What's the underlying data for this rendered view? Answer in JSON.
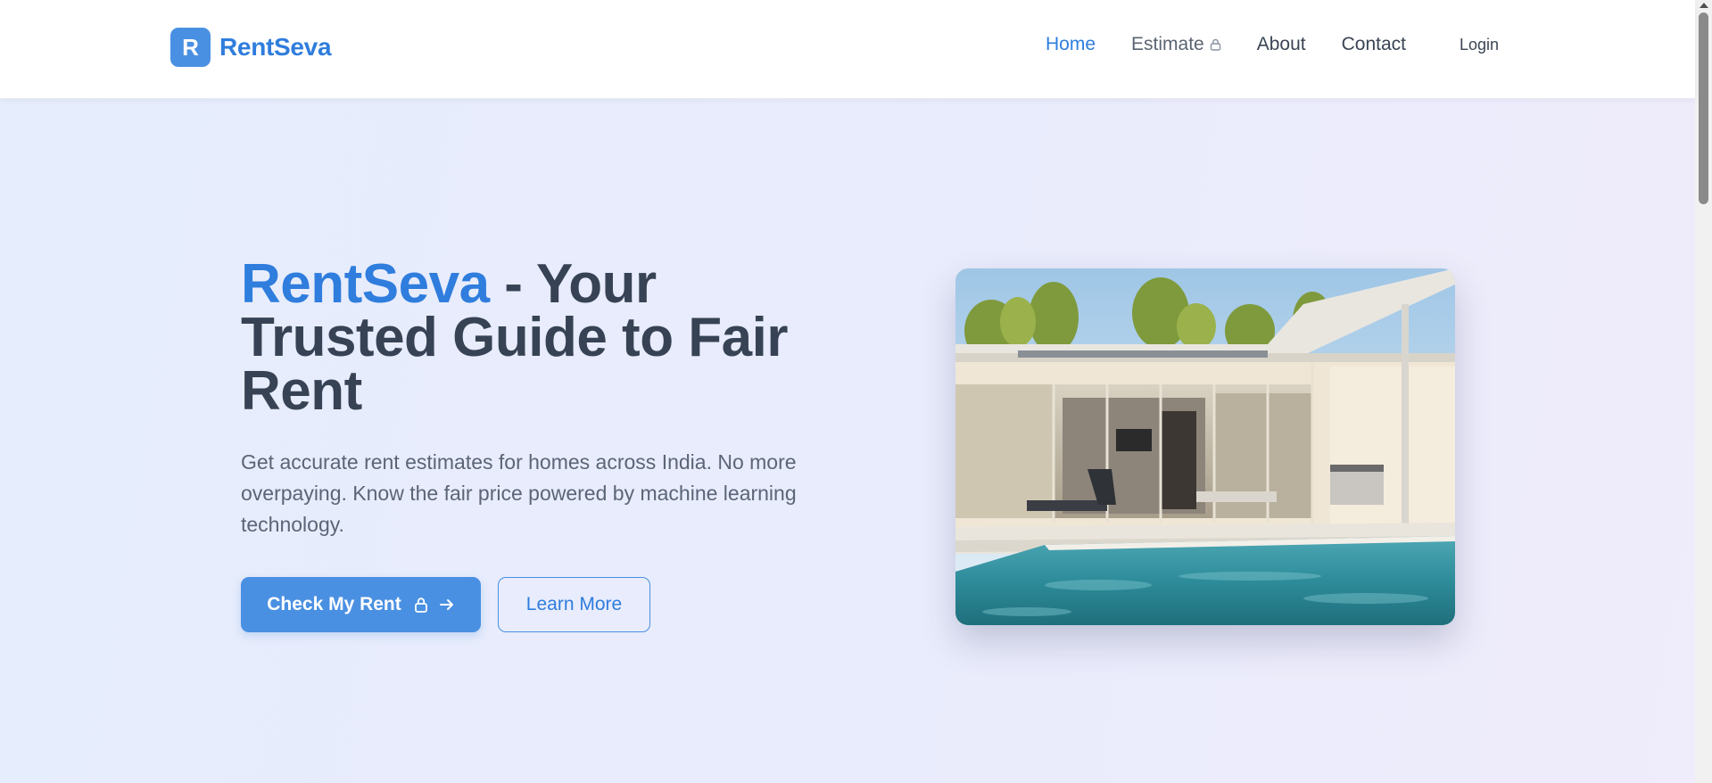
{
  "brand": {
    "logo_letter": "R",
    "name": "RentSeva",
    "accent_color": "#4a90e2"
  },
  "nav": {
    "home": "Home",
    "estimate": "Estimate",
    "about": "About",
    "contact": "Contact",
    "login": "Login",
    "estimate_icon": "lock-icon"
  },
  "hero": {
    "title_brand": "RentSeva",
    "title_rest": " - Your Trusted Guide to Fair Rent",
    "subtitle": "Get accurate rent estimates for homes across India. No more overpaying. Know the fair price powered by machine learning technology.",
    "primary_button": "Check My Rent",
    "primary_button_icons": [
      "lock-icon",
      "arrow-right-icon"
    ],
    "secondary_button": "Learn More",
    "image_subject": "modern house with pool"
  }
}
